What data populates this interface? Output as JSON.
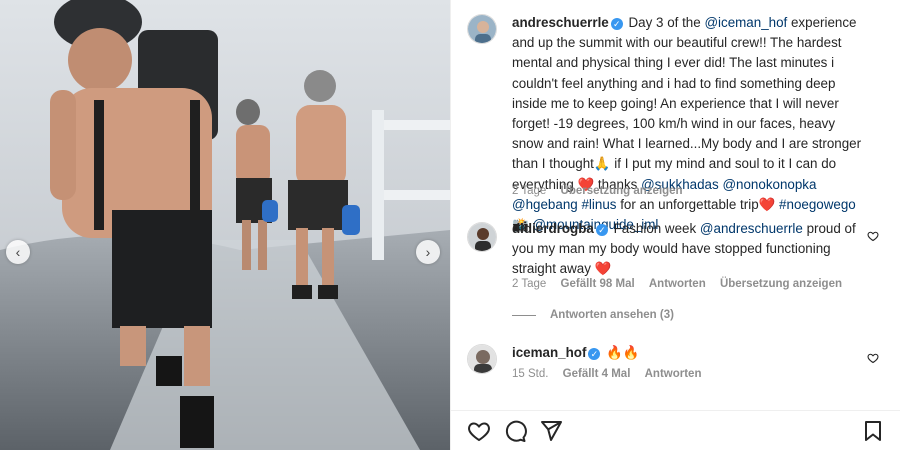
{
  "post": {
    "author": "andreschuerrle",
    "caption_parts": [
      {
        "t": "Day 3 of the ",
        "link": false
      },
      {
        "t": "@iceman_hof",
        "link": true
      },
      {
        "t": " experience and up the summit with our beautiful crew!! The hardest mental and physical thing I ever did! The last minutes i couldn't feel anything and i had to find something deep inside me to keep going! An experience that I will never forget! -19 degrees, 100 km/h wind in our faces, heavy snow and rain! What I learned...My body and I are stronger than I thought🙏 if I put my mind and soul to it I can do everything ❤️ thanks ",
        "link": false
      },
      {
        "t": "@sukkhadas",
        "link": true
      },
      {
        "t": " ",
        "link": false
      },
      {
        "t": "@nonokonopka",
        "link": true
      },
      {
        "t": " ",
        "link": false
      },
      {
        "t": "@hgebang",
        "link": true
      },
      {
        "t": " ",
        "link": false
      },
      {
        "t": "#linus",
        "link": true
      },
      {
        "t": " for an unforgettable trip❤️ ",
        "link": false
      },
      {
        "t": "#noegowego",
        "link": true
      },
      {
        "t": " 📸 ",
        "link": false
      },
      {
        "t": "@mountainguide_iml",
        "link": true
      }
    ],
    "time": "2 Tage",
    "translate": "Übersetzung anzeigen"
  },
  "comments": [
    {
      "user": "didierdrogba",
      "mention": "@andreschuerrle",
      "prefix": "Fashion week ",
      "text": " proud of you my man my body would have stopped functioning straight away ❤️",
      "time": "2 Tage",
      "likes": "Gefällt 98 Mal",
      "reply": "Antworten",
      "translate": "Übersetzung anzeigen",
      "view_replies": "Antworten ansehen (3)"
    },
    {
      "user": "iceman_hof",
      "text": "🔥🔥",
      "time": "15 Std.",
      "likes": "Gefällt 4 Mal",
      "reply": "Antworten"
    }
  ],
  "colors": {
    "link": "#00376b",
    "verified": "#3897f0",
    "meta": "#8e8e8e"
  },
  "icons": {
    "prev": "chevron-left-icon",
    "next": "chevron-right-icon",
    "like": "heart-icon",
    "comment": "comment-icon",
    "share": "send-icon",
    "save": "bookmark-icon"
  },
  "nav": {
    "prev_glyph": "‹",
    "next_glyph": "›"
  }
}
